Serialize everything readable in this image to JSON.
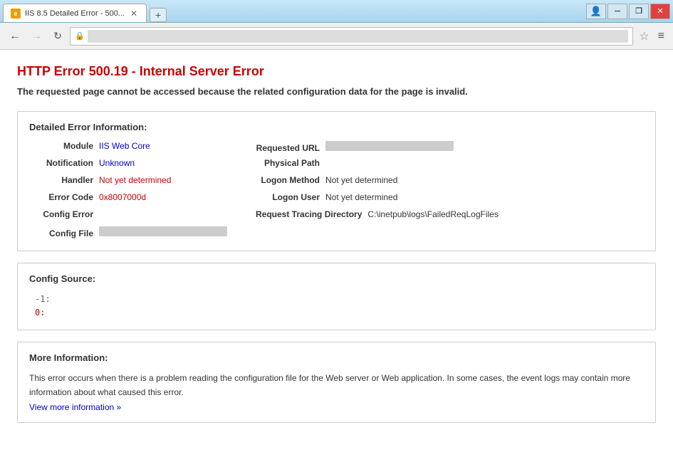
{
  "window": {
    "title_bar": {
      "tab_title": "IIS 8.5 Detailed Error - 500...",
      "favicon_label": "e",
      "new_tab_label": "+",
      "user_btn_label": "👤",
      "minimize_label": "─",
      "restore_label": "❐",
      "close_label": "✕"
    },
    "nav_bar": {
      "back_label": "←",
      "forward_label": "→",
      "refresh_label": "↻",
      "address_placeholder": "",
      "star_label": "☆",
      "menu_label": "≡"
    }
  },
  "page": {
    "error_title": "HTTP Error 500.19 - Internal Server Error",
    "error_description": "The requested page cannot be accessed because the related configuration data for the page is invalid.",
    "detail_section": {
      "title": "Detailed Error Information:",
      "left_fields": [
        {
          "label": "Module",
          "value": "IIS Web Core",
          "style": "link-color"
        },
        {
          "label": "Notification",
          "value": "Unknown",
          "style": "link-color"
        },
        {
          "label": "Handler",
          "value": "Not yet determined",
          "style": "red-link"
        },
        {
          "label": "Error Code",
          "value": "0x8007000d",
          "style": "red-link"
        },
        {
          "label": "Config Error",
          "value": "",
          "style": "normal"
        },
        {
          "label": "Config File",
          "value": "BLURRED",
          "style": "blurred"
        }
      ],
      "right_fields": [
        {
          "label": "Requested URL",
          "value": "BLURRED",
          "style": "blurred"
        },
        {
          "label": "Physical Path",
          "value": "",
          "style": "normal"
        },
        {
          "label": "Logon Method",
          "value": "Not yet determined",
          "style": "normal"
        },
        {
          "label": "Logon User",
          "value": "Not yet determined",
          "style": "normal"
        },
        {
          "label": "Request Tracing Directory",
          "value": "C:\\inetpub\\logs\\FailedReqLogFiles",
          "style": "normal"
        }
      ]
    },
    "config_source": {
      "title": "Config Source:",
      "lines": [
        {
          "text": "-1:",
          "style": "grey"
        },
        {
          "text": "0:",
          "style": "red"
        }
      ]
    },
    "more_information": {
      "title": "More Information:",
      "body": "This error occurs when there is a problem reading the configuration file for the Web server or Web application. In some cases, the event logs may contain more information about what caused this error.",
      "link_text": "View more information »",
      "link_url": "#"
    }
  }
}
